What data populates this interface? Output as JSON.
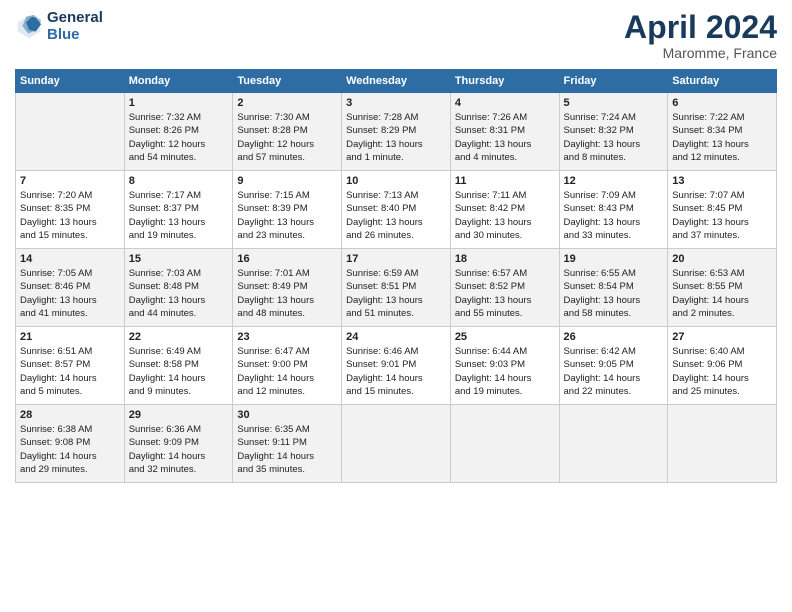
{
  "header": {
    "logo_line1": "General",
    "logo_line2": "Blue",
    "main_title": "April 2024",
    "subtitle": "Maromme, France"
  },
  "columns": [
    "Sunday",
    "Monday",
    "Tuesday",
    "Wednesday",
    "Thursday",
    "Friday",
    "Saturday"
  ],
  "weeks": [
    [
      {
        "day": "",
        "content": ""
      },
      {
        "day": "1",
        "content": "Sunrise: 7:32 AM\nSunset: 8:26 PM\nDaylight: 12 hours\nand 54 minutes."
      },
      {
        "day": "2",
        "content": "Sunrise: 7:30 AM\nSunset: 8:28 PM\nDaylight: 12 hours\nand 57 minutes."
      },
      {
        "day": "3",
        "content": "Sunrise: 7:28 AM\nSunset: 8:29 PM\nDaylight: 13 hours\nand 1 minute."
      },
      {
        "day": "4",
        "content": "Sunrise: 7:26 AM\nSunset: 8:31 PM\nDaylight: 13 hours\nand 4 minutes."
      },
      {
        "day": "5",
        "content": "Sunrise: 7:24 AM\nSunset: 8:32 PM\nDaylight: 13 hours\nand 8 minutes."
      },
      {
        "day": "6",
        "content": "Sunrise: 7:22 AM\nSunset: 8:34 PM\nDaylight: 13 hours\nand 12 minutes."
      }
    ],
    [
      {
        "day": "7",
        "content": "Sunrise: 7:20 AM\nSunset: 8:35 PM\nDaylight: 13 hours\nand 15 minutes."
      },
      {
        "day": "8",
        "content": "Sunrise: 7:17 AM\nSunset: 8:37 PM\nDaylight: 13 hours\nand 19 minutes."
      },
      {
        "day": "9",
        "content": "Sunrise: 7:15 AM\nSunset: 8:39 PM\nDaylight: 13 hours\nand 23 minutes."
      },
      {
        "day": "10",
        "content": "Sunrise: 7:13 AM\nSunset: 8:40 PM\nDaylight: 13 hours\nand 26 minutes."
      },
      {
        "day": "11",
        "content": "Sunrise: 7:11 AM\nSunset: 8:42 PM\nDaylight: 13 hours\nand 30 minutes."
      },
      {
        "day": "12",
        "content": "Sunrise: 7:09 AM\nSunset: 8:43 PM\nDaylight: 13 hours\nand 33 minutes."
      },
      {
        "day": "13",
        "content": "Sunrise: 7:07 AM\nSunset: 8:45 PM\nDaylight: 13 hours\nand 37 minutes."
      }
    ],
    [
      {
        "day": "14",
        "content": "Sunrise: 7:05 AM\nSunset: 8:46 PM\nDaylight: 13 hours\nand 41 minutes."
      },
      {
        "day": "15",
        "content": "Sunrise: 7:03 AM\nSunset: 8:48 PM\nDaylight: 13 hours\nand 44 minutes."
      },
      {
        "day": "16",
        "content": "Sunrise: 7:01 AM\nSunset: 8:49 PM\nDaylight: 13 hours\nand 48 minutes."
      },
      {
        "day": "17",
        "content": "Sunrise: 6:59 AM\nSunset: 8:51 PM\nDaylight: 13 hours\nand 51 minutes."
      },
      {
        "day": "18",
        "content": "Sunrise: 6:57 AM\nSunset: 8:52 PM\nDaylight: 13 hours\nand 55 minutes."
      },
      {
        "day": "19",
        "content": "Sunrise: 6:55 AM\nSunset: 8:54 PM\nDaylight: 13 hours\nand 58 minutes."
      },
      {
        "day": "20",
        "content": "Sunrise: 6:53 AM\nSunset: 8:55 PM\nDaylight: 14 hours\nand 2 minutes."
      }
    ],
    [
      {
        "day": "21",
        "content": "Sunrise: 6:51 AM\nSunset: 8:57 PM\nDaylight: 14 hours\nand 5 minutes."
      },
      {
        "day": "22",
        "content": "Sunrise: 6:49 AM\nSunset: 8:58 PM\nDaylight: 14 hours\nand 9 minutes."
      },
      {
        "day": "23",
        "content": "Sunrise: 6:47 AM\nSunset: 9:00 PM\nDaylight: 14 hours\nand 12 minutes."
      },
      {
        "day": "24",
        "content": "Sunrise: 6:46 AM\nSunset: 9:01 PM\nDaylight: 14 hours\nand 15 minutes."
      },
      {
        "day": "25",
        "content": "Sunrise: 6:44 AM\nSunset: 9:03 PM\nDaylight: 14 hours\nand 19 minutes."
      },
      {
        "day": "26",
        "content": "Sunrise: 6:42 AM\nSunset: 9:05 PM\nDaylight: 14 hours\nand 22 minutes."
      },
      {
        "day": "27",
        "content": "Sunrise: 6:40 AM\nSunset: 9:06 PM\nDaylight: 14 hours\nand 25 minutes."
      }
    ],
    [
      {
        "day": "28",
        "content": "Sunrise: 6:38 AM\nSunset: 9:08 PM\nDaylight: 14 hours\nand 29 minutes."
      },
      {
        "day": "29",
        "content": "Sunrise: 6:36 AM\nSunset: 9:09 PM\nDaylight: 14 hours\nand 32 minutes."
      },
      {
        "day": "30",
        "content": "Sunrise: 6:35 AM\nSunset: 9:11 PM\nDaylight: 14 hours\nand 35 minutes."
      },
      {
        "day": "",
        "content": ""
      },
      {
        "day": "",
        "content": ""
      },
      {
        "day": "",
        "content": ""
      },
      {
        "day": "",
        "content": ""
      }
    ]
  ]
}
